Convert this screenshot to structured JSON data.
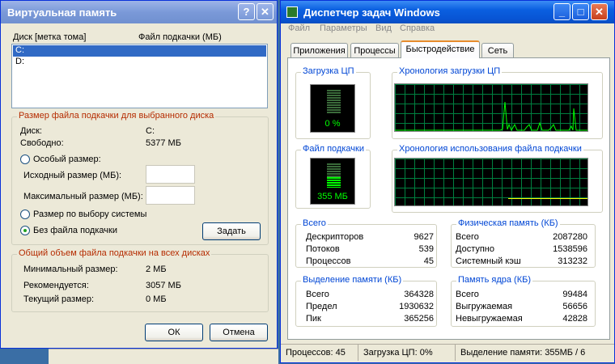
{
  "vm": {
    "title": "Виртуальная память",
    "col_drive": "Диск [метка тома]",
    "col_pagefile": "Файл подкачки (МБ)",
    "drives": [
      "C:",
      "D:"
    ],
    "selected_group_title": "Размер файла подкачки для выбранного диска",
    "drive_label": "Диск:",
    "drive_value": "C:",
    "free_label": "Свободно:",
    "free_value": "5377 МБ",
    "custom_size": "Особый размер:",
    "initial_size": "Исходный размер (МБ):",
    "max_size": "Максимальный размер (МБ):",
    "system_managed": "Размер по выбору системы",
    "no_pagefile": "Без файла подкачки",
    "set_button": "Задать",
    "total_group_title": "Общий объем файла подкачки на всех дисках",
    "min_label": "Минимальный размер:",
    "min_value": "2 МБ",
    "rec_label": "Рекомендуется:",
    "rec_value": "3057 МБ",
    "cur_label": "Текущий размер:",
    "cur_value": "0 МБ",
    "ok": "ОК",
    "cancel": "Отмена",
    "help_btn": "?",
    "close_btn": "✕"
  },
  "tm": {
    "title": "Диспетчер задач Windows",
    "min_btn": "_",
    "max_btn": "□",
    "close_btn": "✕",
    "menu": [
      "Файл",
      "Параметры",
      "Вид",
      "Справка"
    ],
    "tabs": [
      "Приложения",
      "Процессы",
      "Быстродействие",
      "Сеть"
    ],
    "active_tab": 2,
    "cpu_usage_title": "Загрузка ЦП",
    "cpu_usage_value": "0 %",
    "cpu_usage_fraction": 0.0,
    "cpu_history_title": "Хронология загрузки ЦП",
    "pf_usage_title": "Файл подкачки",
    "pf_usage_value": "355 МБ",
    "pf_usage_fraction": 0.17,
    "pf_history_title": "Хронология использования файла подкачки",
    "totals": {
      "title": "Всего",
      "rows": [
        {
          "label": "Дескрипторов",
          "value": "9627"
        },
        {
          "label": "Потоков",
          "value": "539"
        },
        {
          "label": "Процессов",
          "value": "45"
        }
      ]
    },
    "physical": {
      "title": "Физическая память (КБ)",
      "rows": [
        {
          "label": "Всего",
          "value": "2087280"
        },
        {
          "label": "Доступно",
          "value": "1538596"
        },
        {
          "label": "Системный кэш",
          "value": "313232"
        }
      ]
    },
    "commit": {
      "title": "Выделение памяти (КБ)",
      "rows": [
        {
          "label": "Всего",
          "value": "364328"
        },
        {
          "label": "Предел",
          "value": "1930632"
        },
        {
          "label": "Пик",
          "value": "365256"
        }
      ]
    },
    "kernel": {
      "title": "Память ядра (КБ)",
      "rows": [
        {
          "label": "Всего",
          "value": "99484"
        },
        {
          "label": "Выгружаемая",
          "value": "56656"
        },
        {
          "label": "Невыгружаемая",
          "value": "42828"
        }
      ]
    },
    "status": {
      "processes": "Процессов: 45",
      "cpu": "Загрузка ЦП: 0%",
      "commit": "Выделение памяти: 355МБ / 6"
    }
  },
  "colors": {
    "title_blue": "#0a5fe0",
    "group_red": "#b52b00",
    "graph_green": "#00ff00",
    "graph_yellow": "#ffff00"
  }
}
